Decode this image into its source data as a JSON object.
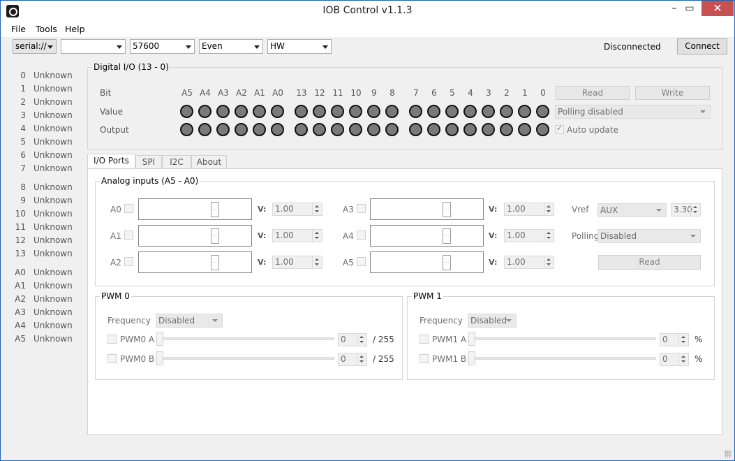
{
  "window": {
    "title": "IOB Control v1.1.3",
    "minimize_icon": "minimize-icon",
    "maximize_icon": "maximize-icon",
    "close_icon": "close-icon"
  },
  "menu": {
    "items": [
      "File",
      "Tools",
      "Help"
    ]
  },
  "toolbar": {
    "protocol": "serial://",
    "port": "",
    "baud": "57600",
    "parity": "Even",
    "flow": "HW",
    "status": "Disconnected",
    "connect_label": "Connect"
  },
  "pins": [
    {
      "num": "0",
      "state": "Unknown"
    },
    {
      "num": "1",
      "state": "Unknown"
    },
    {
      "num": "2",
      "state": "Unknown"
    },
    {
      "num": "3",
      "state": "Unknown"
    },
    {
      "num": "4",
      "state": "Unknown"
    },
    {
      "num": "5",
      "state": "Unknown"
    },
    {
      "num": "6",
      "state": "Unknown"
    },
    {
      "num": "7",
      "state": "Unknown"
    },
    {
      "num": "8",
      "state": "Unknown"
    },
    {
      "num": "9",
      "state": "Unknown"
    },
    {
      "num": "10",
      "state": "Unknown"
    },
    {
      "num": "11",
      "state": "Unknown"
    },
    {
      "num": "12",
      "state": "Unknown"
    },
    {
      "num": "13",
      "state": "Unknown"
    },
    {
      "num": "A0",
      "state": "Unknown"
    },
    {
      "num": "A1",
      "state": "Unknown"
    },
    {
      "num": "A2",
      "state": "Unknown"
    },
    {
      "num": "A3",
      "state": "Unknown"
    },
    {
      "num": "A4",
      "state": "Unknown"
    },
    {
      "num": "A5",
      "state": "Unknown"
    }
  ],
  "digital_io": {
    "title": "Digital I/O (13 - 0)",
    "row_bit": "Bit",
    "row_value": "Value",
    "row_output": "Output",
    "bits": [
      "A5",
      "A4",
      "A3",
      "A2",
      "A1",
      "A0",
      "13",
      "12",
      "11",
      "10",
      "9",
      "8",
      "7",
      "6",
      "5",
      "4",
      "3",
      "2",
      "1",
      "0"
    ],
    "read_label": "Read",
    "write_label": "Write",
    "polling": "Polling disabled",
    "auto_update": "Auto update",
    "auto_update_checked": true
  },
  "tabs": [
    "I/O Ports",
    "SPI",
    "I2C",
    "About"
  ],
  "analog": {
    "title": "Analog inputs (A5 - A0)",
    "v_label": "V:",
    "channels": [
      {
        "name": "A0",
        "voltage": "1.00"
      },
      {
        "name": "A1",
        "voltage": "1.00"
      },
      {
        "name": "A2",
        "voltage": "1.00"
      },
      {
        "name": "A3",
        "voltage": "1.00"
      },
      {
        "name": "A4",
        "voltage": "1.00"
      },
      {
        "name": "A5",
        "voltage": "1.00"
      }
    ],
    "vref_label": "Vref",
    "vref_source": "AUX",
    "vref_value": "3.30",
    "polling_label": "Polling",
    "polling_value": "Disabled",
    "read_label": "Read"
  },
  "pwm0": {
    "title": "PWM 0",
    "frequency_label": "Frequency",
    "frequency": "Disabled",
    "a_label": "PWM0 A",
    "a_value": "0",
    "a_suffix": "/ 255",
    "b_label": "PWM0 B",
    "b_value": "0",
    "b_suffix": "/ 255"
  },
  "pwm1": {
    "title": "PWM 1",
    "frequency_label": "Frequency",
    "frequency": "Disabled",
    "a_label": "PWM1 A",
    "a_value": "0",
    "a_suffix": "%",
    "b_label": "PWM1 B",
    "b_value": "0",
    "b_suffix": "%"
  }
}
